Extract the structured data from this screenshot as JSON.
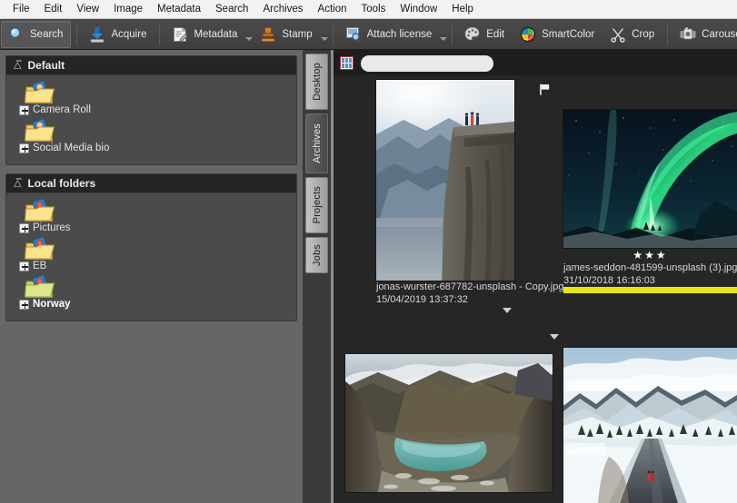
{
  "menu": {
    "items": [
      {
        "label": "File"
      },
      {
        "label": "Edit"
      },
      {
        "label": "View"
      },
      {
        "label": "Image"
      },
      {
        "label": "Metadata"
      },
      {
        "label": "Search"
      },
      {
        "label": "Archives"
      },
      {
        "label": "Action"
      },
      {
        "label": "Tools"
      },
      {
        "label": "Window"
      },
      {
        "label": "Help"
      }
    ]
  },
  "toolbar": {
    "buttons": [
      {
        "label": "Search",
        "icon": "magnifier-icon",
        "active": true,
        "caret": false
      },
      {
        "label": "Acquire",
        "icon": "download-icon",
        "active": false,
        "caret": false
      },
      {
        "label": "Metadata",
        "icon": "document-edit-icon",
        "active": false,
        "caret": true
      },
      {
        "label": "Stamp",
        "icon": "stamp-icon",
        "active": false,
        "caret": true
      },
      {
        "label": "Attach license",
        "icon": "license-icon",
        "active": false,
        "caret": true
      },
      {
        "label": "Edit",
        "icon": "palette-icon",
        "active": false,
        "caret": false
      },
      {
        "label": "SmartColor",
        "icon": "color-wheel-icon",
        "active": false,
        "caret": false
      },
      {
        "label": "Crop",
        "icon": "scissors-icon",
        "active": false,
        "caret": false
      },
      {
        "label": "Carousel",
        "icon": "carousel-icon",
        "active": false,
        "caret": false
      },
      {
        "label": "",
        "icon": "scales-icon",
        "active": false,
        "caret": false
      }
    ]
  },
  "sidebar": {
    "panels": [
      {
        "title": "Default",
        "collapse_icon": "chevron-up-icon",
        "items": [
          {
            "label": "Camera Roll",
            "icon": "folder-image-icon",
            "selected": false
          },
          {
            "label": "Social Media bio",
            "icon": "folder-image-icon",
            "selected": false
          }
        ]
      },
      {
        "title": "Local folders",
        "collapse_icon": "chevron-up-icon",
        "items": [
          {
            "label": "Pictures",
            "icon": "folder-image-icon",
            "selected": false
          },
          {
            "label": "EB",
            "icon": "folder-image-icon",
            "selected": false
          },
          {
            "label": "Norway",
            "icon": "folder-image-green-icon",
            "selected": true
          }
        ]
      }
    ]
  },
  "tabstrip": {
    "tabs": [
      {
        "label": "Desktop",
        "active": false
      },
      {
        "label": "Archives",
        "active": true
      },
      {
        "label": "Projects",
        "active": false
      },
      {
        "label": "Jobs",
        "active": false
      }
    ]
  },
  "browser": {
    "grid_toggle_icon": "grid-view-icon",
    "search": {
      "icon": "magnifier-icon",
      "value": "",
      "placeholder": ""
    },
    "thumbnails": [
      {
        "filename": "jonas-wurster-687782-unsplash - Copy.jpg",
        "timestamp": "15/04/2019 13:37:32",
        "rating": 0,
        "color_label": "",
        "flag": true,
        "caret_icon": "chevron-down-icon",
        "image_alt": "cliff-over-fjord-with-three-people"
      },
      {
        "filename": "james-seddon-481599-unsplash (3).jpg",
        "timestamp": "31/10/2018 16:16:03",
        "rating": 3,
        "color_label": "#e8e413",
        "flag": false,
        "caret_icon": "chevron-down-icon",
        "image_alt": "green-aurora-over-night-sky"
      },
      {
        "filename": "",
        "timestamp": "",
        "rating": 0,
        "color_label": "",
        "flag": false,
        "caret_icon": "",
        "image_alt": "mountain-valley-with-turquoise-lake"
      },
      {
        "filename": "",
        "timestamp": "",
        "rating": 0,
        "color_label": "",
        "flag": false,
        "caret_icon": "",
        "image_alt": "snowy-road-with-two-people"
      }
    ]
  },
  "colors": {
    "menubar_bg": "#f2f2f2",
    "toolbar_bg": "#454545",
    "sidebar_bg": "#666666",
    "panel_bg": "#4b4b4b",
    "panel_header_bg": "#252525",
    "browser_bg": "#262626",
    "accent_yellow": "#e8e413",
    "star_color": "#ffffff"
  }
}
